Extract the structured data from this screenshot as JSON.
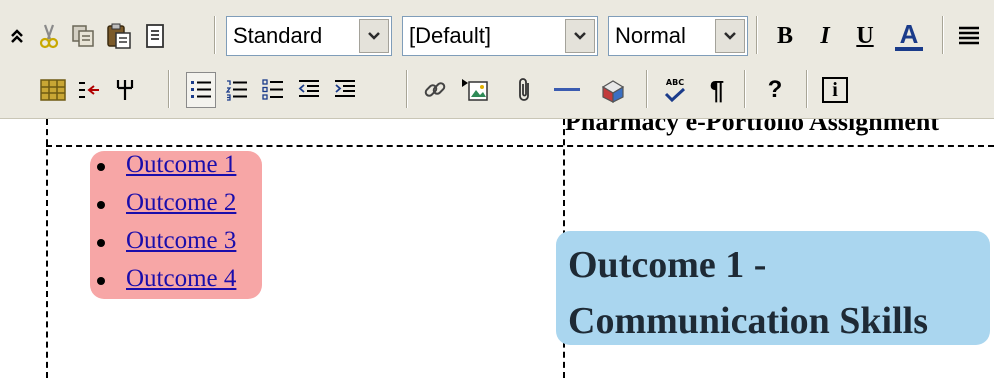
{
  "toolbar": {
    "style_select": {
      "value": "Standard"
    },
    "font_select": {
      "value": "[Default]"
    },
    "size_select": {
      "value": "Normal"
    },
    "bold_label": "B",
    "italic_label": "I",
    "underline_label": "U",
    "font_color_label": "A",
    "special_char_label": "¶",
    "help_label": "?",
    "info_label": "i",
    "spell_label": "ABC",
    "accent_color": "#1a3b8a",
    "icons": [
      "collapse-icon",
      "cut-icon",
      "copy-icon",
      "paste-icon",
      "paste-text-icon",
      "bold-icon",
      "italic-icon",
      "underline-icon",
      "font-color-icon",
      "align-icon",
      "table-icon",
      "split-cell-icon",
      "merge-cells-icon",
      "bullet-list-icon",
      "numbered-list-icon",
      "checklist-icon",
      "outdent-icon",
      "indent-icon",
      "link-icon",
      "image-icon",
      "attachment-icon",
      "horizontal-rule-icon",
      "embed-media-icon",
      "spellcheck-icon",
      "paragraph-mark-icon",
      "help-icon",
      "info-icon"
    ]
  },
  "editor": {
    "page_title": "Pharmacy e-Portfolio Assignment",
    "outcome_links": [
      {
        "label": "Outcome 1"
      },
      {
        "label": "Outcome 2"
      },
      {
        "label": "Outcome 3"
      },
      {
        "label": "Outcome 4"
      }
    ],
    "heading": "Outcome 1 - Communication Skills",
    "colors": {
      "list_bg": "#f7a6a6",
      "heading_bg": "#aad6ef",
      "link": "#1a0dab"
    }
  }
}
